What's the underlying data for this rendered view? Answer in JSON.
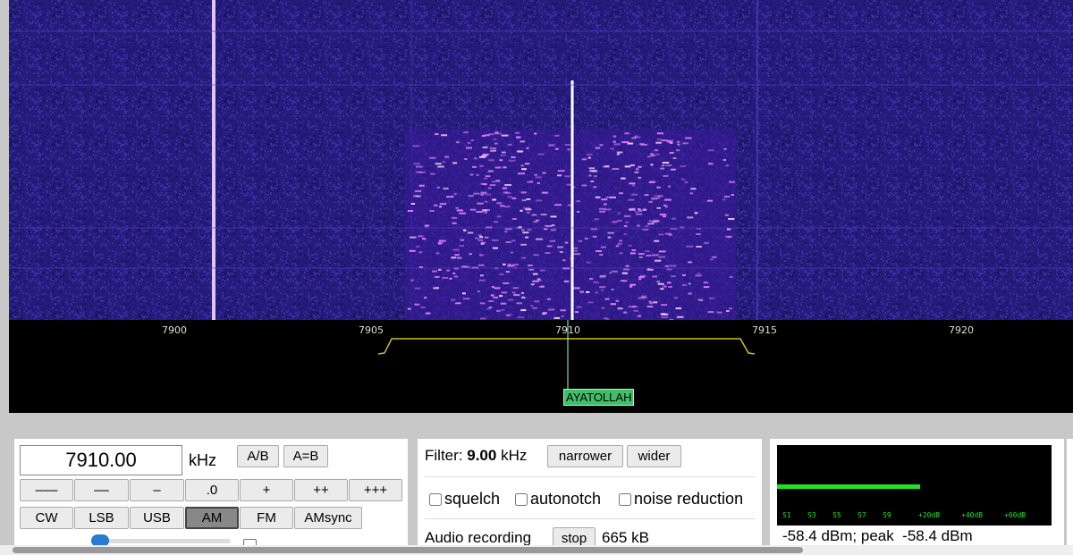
{
  "waterfall": {
    "background_color": "#241c7a",
    "signal_color": "#e080ff"
  },
  "scale": {
    "ticks": [
      "7900",
      "7905",
      "7910",
      "7915",
      "7920"
    ],
    "marker_label": "AYATOLLAH",
    "passband_color": "#c8c020"
  },
  "tuning": {
    "frequency": "7910.00",
    "unit": "kHz",
    "ab_label": "A/B",
    "a_eq_b_label": "A=B",
    "step_buttons": [
      "–––",
      "––",
      "–",
      ".0",
      "+",
      "++",
      "+++"
    ],
    "modes": [
      "CW",
      "LSB",
      "USB",
      "AM",
      "FM",
      "AMsync"
    ],
    "active_mode": "AM"
  },
  "filter": {
    "label": "Filter:",
    "width": "9.00",
    "unit": "kHz",
    "narrower_label": "narrower",
    "wider_label": "wider"
  },
  "options": {
    "squelch": "squelch",
    "autonotch": "autonotch",
    "noise_reduction": "noise reduction"
  },
  "recording": {
    "label": "Audio recording",
    "stop_label": "stop",
    "size": "665 kB"
  },
  "smeter": {
    "ticks": [
      "S1",
      "S3",
      "S5",
      "S7",
      "S9",
      "+20dB",
      "+40dB",
      "+60dB"
    ],
    "level_fraction": 0.52,
    "readout": "-58.4 dBm; peak  -58.4 dBm",
    "bar_color": "#22e022"
  }
}
